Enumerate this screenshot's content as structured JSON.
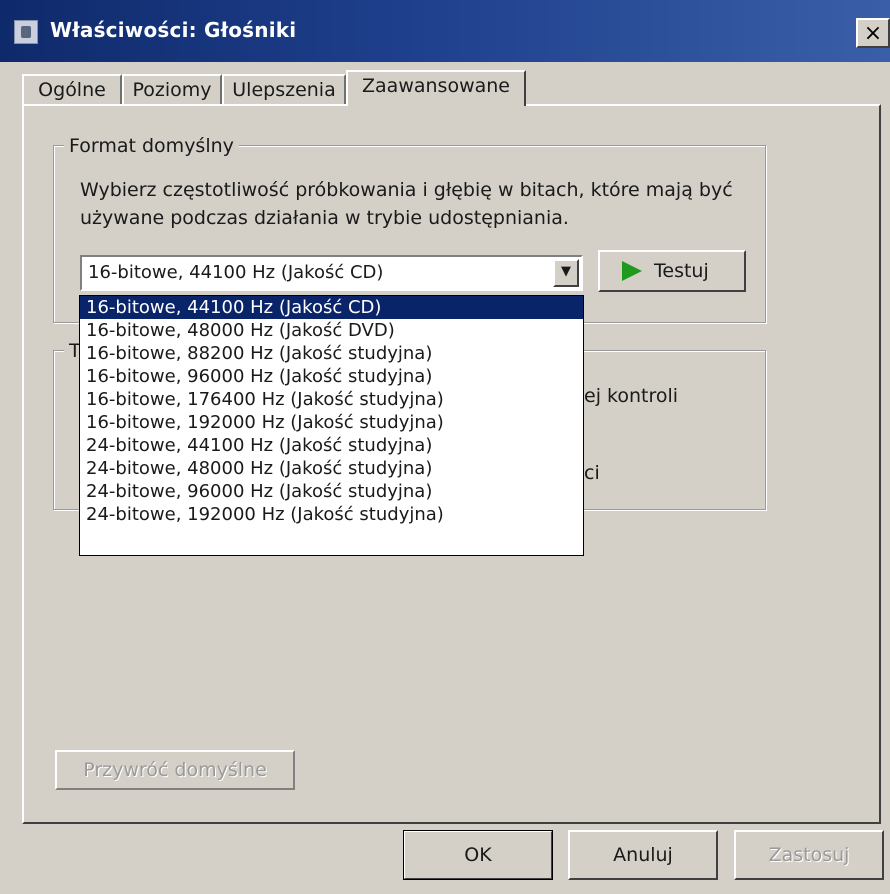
{
  "window": {
    "title": "Właściwości: Głośniki",
    "close_label": "×"
  },
  "tabs": [
    {
      "label": "Ogólne",
      "active": false
    },
    {
      "label": "Poziomy",
      "active": false
    },
    {
      "label": "Ulepszenia",
      "active": false
    },
    {
      "label": "Zaawansowane",
      "active": true
    }
  ],
  "default_format": {
    "group_title": "Format domyślny",
    "description": "Wybierz częstotliwość próbkowania i głębię w bitach, które mają być używane podczas działania w trybie udostępniania.",
    "selected": "16-bitowe, 44100 Hz (Jakość CD)",
    "test_label": "Testuj",
    "options": [
      "16-bitowe, 44100 Hz (Jakość CD)",
      "16-bitowe, 48000 Hz (Jakość DVD)",
      "16-bitowe, 88200 Hz (Jakość studyjna)",
      "16-bitowe, 96000 Hz (Jakość studyjna)",
      "16-bitowe, 176400 Hz (Jakość studyjna)",
      "16-bitowe, 192000 Hz (Jakość studyjna)",
      "24-bitowe, 44100 Hz (Jakość studyjna)",
      "24-bitowe, 48000 Hz (Jakość studyjna)",
      "24-bitowe, 96000 Hz (Jakość studyjna)",
      "24-bitowe, 192000 Hz (Jakość studyjna)"
    ]
  },
  "exclusive_group": {
    "title_fragment": "T",
    "line1_fragment": "ej kontroli",
    "line2_fragment": "ci"
  },
  "restore_defaults_label": "Przywróć domyślne",
  "buttons": {
    "ok": "OK",
    "cancel": "Anuluj",
    "apply": "Zastosuj"
  },
  "colors": {
    "selection": "#0a246a",
    "titlebar": "#0f2a6b",
    "play_icon": "#1f9a1f"
  }
}
